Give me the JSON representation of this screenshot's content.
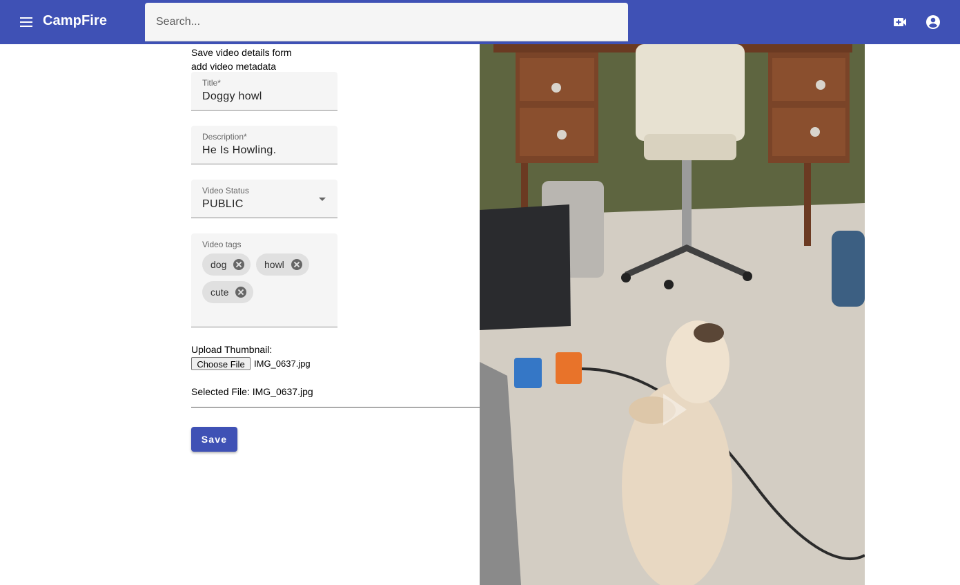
{
  "app": {
    "brand": "CampFire",
    "search_placeholder": "Search...",
    "icons": {
      "menu": "menu-icon",
      "upload": "video-call-icon",
      "account": "account-circle-icon"
    }
  },
  "form": {
    "heading_line1": "Save video details form",
    "heading_line2": "add video metadata",
    "title": {
      "label": "Title*",
      "value": "Doggy howl"
    },
    "description": {
      "label": "Description*",
      "value": "He Is Howling."
    },
    "status": {
      "label": "Video Status",
      "value": "PUBLIC"
    },
    "tags": {
      "label": "Video tags",
      "items": [
        "dog",
        "howl",
        "cute"
      ]
    },
    "thumbnail": {
      "label": "Upload Thumbnail:",
      "button": "Choose File",
      "file_name": "IMG_0637.jpg",
      "selected_text": "Selected File: IMG_0637.jpg"
    },
    "save_label": "Save"
  },
  "colors": {
    "primary": "#3f51b5",
    "field_bg": "#f5f5f5",
    "chip_bg": "#e0e0e0"
  }
}
